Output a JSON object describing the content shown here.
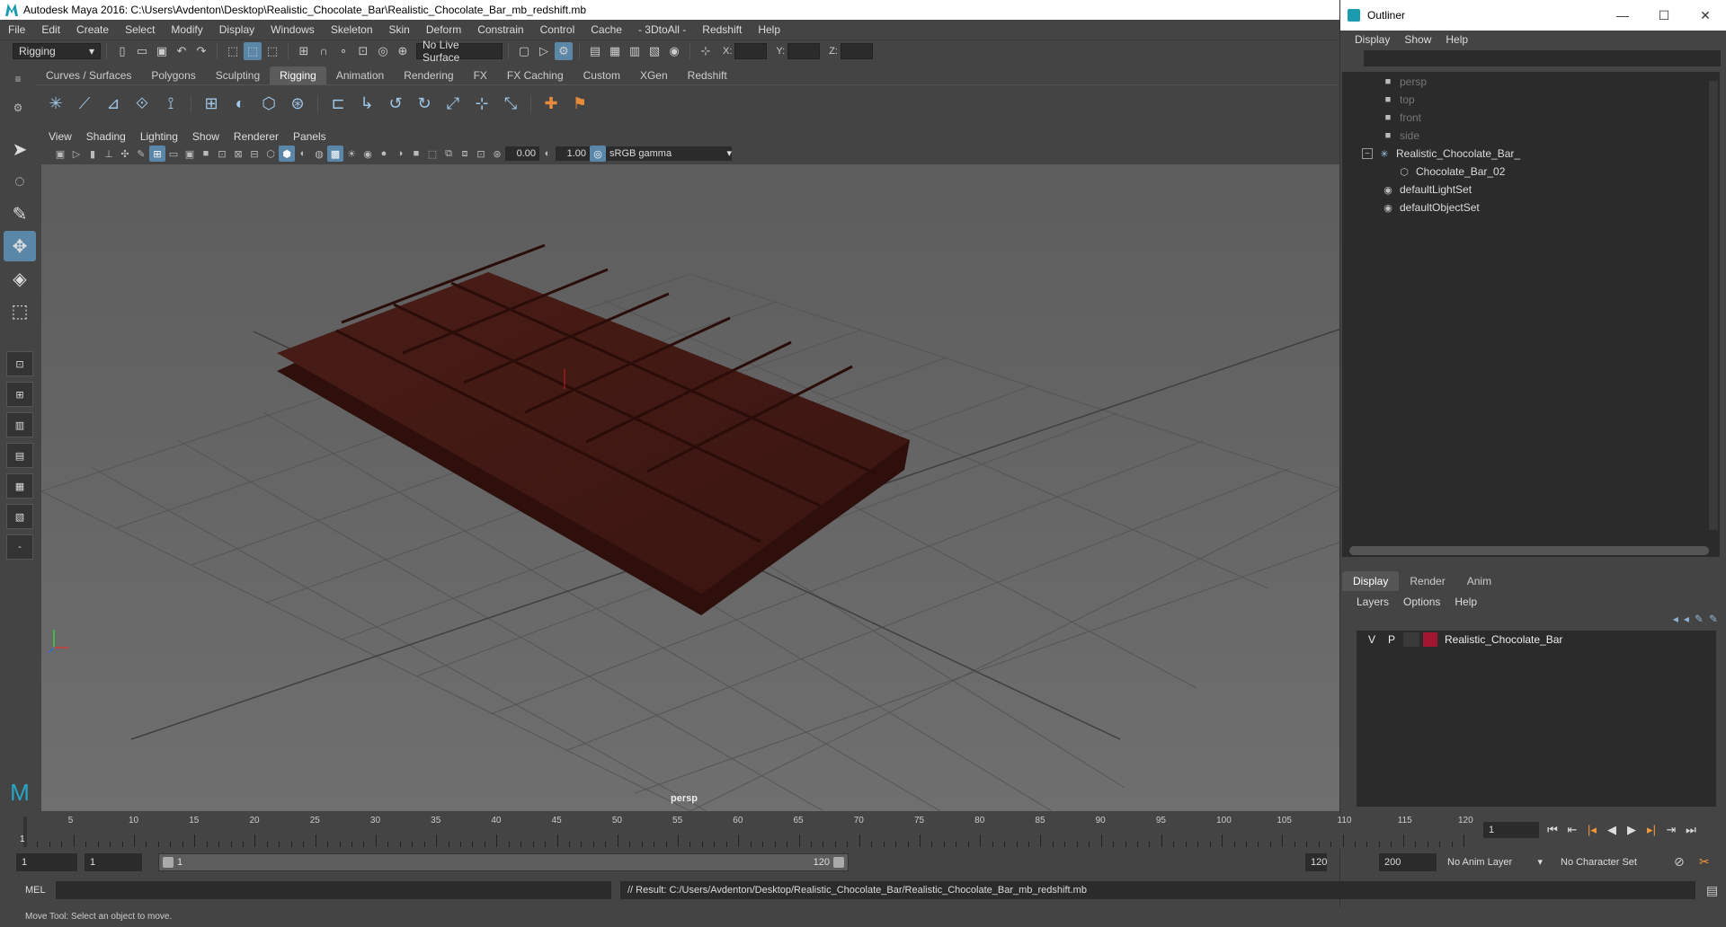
{
  "window": {
    "title": "Autodesk Maya 2016: C:\\Users\\Avdenton\\Desktop\\Realistic_Chocolate_Bar\\Realistic_Chocolate_Bar_mb_redshift.mb"
  },
  "menubar": [
    "File",
    "Edit",
    "Create",
    "Select",
    "Modify",
    "Display",
    "Windows",
    "Skeleton",
    "Skin",
    "Deform",
    "Constrain",
    "Control",
    "Cache",
    "- 3DtoAll -",
    "Redshift",
    "Help"
  ],
  "statusline": {
    "menuset": "Rigging",
    "live_surface": "No Live Surface",
    "x_label": "X:",
    "y_label": "Y:",
    "z_label": "Z:"
  },
  "shelf": {
    "tabs": [
      "Curves / Surfaces",
      "Polygons",
      "Sculpting",
      "Rigging",
      "Animation",
      "Rendering",
      "FX",
      "FX Caching",
      "Custom",
      "XGen",
      "Redshift"
    ],
    "active_tab": "Rigging"
  },
  "panel": {
    "menu": [
      "View",
      "Shading",
      "Lighting",
      "Show",
      "Renderer",
      "Panels"
    ],
    "exposure": "0.00",
    "gamma_value": "1.00",
    "color_space": "sRGB gamma",
    "camera_label": "persp"
  },
  "outliner": {
    "title": "Outliner",
    "menu": [
      "Display",
      "Show",
      "Help"
    ],
    "items": [
      {
        "label": "persp",
        "dim": true,
        "icon": "camera-icon"
      },
      {
        "label": "top",
        "dim": true,
        "icon": "camera-icon"
      },
      {
        "label": "front",
        "dim": true,
        "icon": "camera-icon"
      },
      {
        "label": "side",
        "dim": true,
        "icon": "camera-icon"
      },
      {
        "label": "Realistic_Chocolate_Bar_",
        "dim": false,
        "icon": "group-icon"
      },
      {
        "label": "Chocolate_Bar_02",
        "dim": false,
        "icon": "mesh-icon"
      },
      {
        "label": "defaultLightSet",
        "dim": false,
        "icon": "set-icon"
      },
      {
        "label": "defaultObjectSet",
        "dim": false,
        "icon": "set-icon"
      }
    ]
  },
  "channel_box": {
    "tabs": [
      "Display",
      "Render",
      "Anim"
    ],
    "active_tab": "Display",
    "layer_menu": [
      "Layers",
      "Options",
      "Help"
    ],
    "layers": [
      {
        "v": "V",
        "p": "P",
        "name": "Realistic_Chocolate_Bar",
        "color": "#a3162f"
      }
    ]
  },
  "timeline": {
    "ticks": [
      "5",
      "10",
      "15",
      "20",
      "25",
      "30",
      "35",
      "40",
      "45",
      "50",
      "55",
      "60",
      "65",
      "70",
      "75",
      "80",
      "85",
      "90",
      "95",
      "100",
      "105",
      "110",
      "115",
      "120"
    ],
    "current_frame_marker": "1",
    "current_frame": "1"
  },
  "range": {
    "start": "1",
    "anim_start": "1",
    "range_start_label": "1",
    "range_end_label": "120",
    "anim_end": "120",
    "end": "200",
    "anim_layer": "No Anim Layer",
    "character_set": "No Character Set"
  },
  "command": {
    "language": "MEL",
    "result": "// Result: C:/Users/Avdenton/Desktop/Realistic_Chocolate_Bar/Realistic_Chocolate_Bar_mb_redshift.mb"
  },
  "helpline": "Move Tool: Select an object to move."
}
